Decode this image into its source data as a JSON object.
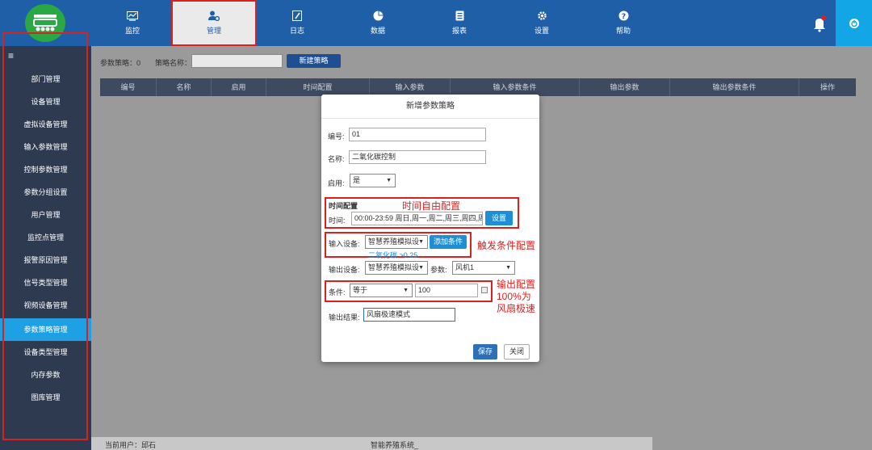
{
  "nav": [
    {
      "label": "监控",
      "icon": "chart-line-icon"
    },
    {
      "label": "管理",
      "icon": "user-gear-icon"
    },
    {
      "label": "日志",
      "icon": "log-edit-icon"
    },
    {
      "label": "数据",
      "icon": "pie-chart-icon"
    },
    {
      "label": "报表",
      "icon": "report-icon"
    },
    {
      "label": "设置",
      "icon": "gear-icon"
    },
    {
      "label": "帮助",
      "icon": "help-icon"
    }
  ],
  "sidebar": {
    "toggle": "≡",
    "items": [
      {
        "label": "部门管理"
      },
      {
        "label": "设备管理"
      },
      {
        "label": "虚拟设备管理"
      },
      {
        "label": "输入参数管理"
      },
      {
        "label": "控制参数管理"
      },
      {
        "label": "参数分组设置"
      },
      {
        "label": "用户管理"
      },
      {
        "label": "监控点管理"
      },
      {
        "label": "报警原因管理"
      },
      {
        "label": "信号类型管理"
      },
      {
        "label": "视频设备管理"
      },
      {
        "label": "参数策略管理"
      },
      {
        "label": "设备类型管理"
      },
      {
        "label": "内存参数"
      },
      {
        "label": "图库管理"
      }
    ],
    "active_index": 11
  },
  "toolbar": {
    "strategy_count": "参数策略：0",
    "name_label": "策略名称：",
    "name_value": "",
    "new_button": "新建策略"
  },
  "table": {
    "headers": [
      "编号",
      "名称",
      "启用",
      "时间配置",
      "输入参数",
      "输入参数条件",
      "输出参数",
      "输出参数条件",
      "操作"
    ]
  },
  "status": {
    "user": "当前用户：邱石",
    "system": "智能养殖系统_"
  },
  "modal": {
    "title": "新增参数策略",
    "id_label": "编号:",
    "id_value": "01",
    "name_label": "名称:",
    "name_value": "二氧化碳控制",
    "enable_label": "启用:",
    "enable_value": "是",
    "time_heading": "时间配置",
    "time_label": "时间:",
    "time_value": "00:00-23:59 周日,周一,周二,周三,周四,周",
    "time_button": "设置",
    "input_device_label": "输入设备:",
    "input_device_value": "智慧养殖模拟设",
    "add_condition_button": "添加条件",
    "input_condition_text": "二氧化碳 >0.25",
    "output_device_label": "输出设备:",
    "output_device_value": "智慧养殖模拟设",
    "param_label": "参数:",
    "param_value": "风机1",
    "condition_label": "条件:",
    "condition_op": "等于",
    "condition_value": "100",
    "result_label": "输出结果:",
    "result_value": "风扇极速模式",
    "save_button": "保存",
    "close_button": "关闭"
  },
  "annotations": {
    "time": "时间自由配置",
    "trigger": "触发条件配置",
    "output_line1": "输出配置",
    "output_line2": "100%为",
    "output_line3": "风扇极速"
  },
  "colors": {
    "topbar": "#1f5fa8",
    "sidebar": "#2e3a4f",
    "active": "#1ea1e4",
    "annotation": "#e31e1e"
  }
}
